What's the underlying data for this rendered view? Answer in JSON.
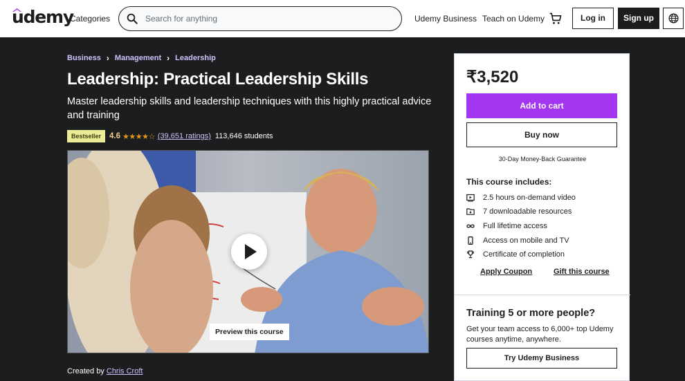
{
  "header": {
    "logo": "udemy",
    "categories": "Categories",
    "search_placeholder": "Search for anything",
    "udemy_business": "Udemy Business",
    "teach": "Teach on Udemy",
    "login": "Log in",
    "signup": "Sign up"
  },
  "breadcrumb": [
    "Business",
    "Management",
    "Leadership"
  ],
  "course": {
    "title": "Leadership: Practical Leadership Skills",
    "subtitle": "Master leadership skills and leadership techniques with this highly practical advice and training",
    "badge": "Bestseller",
    "rating": "4.6",
    "stars": "★★★★☆",
    "ratings_count": "(39,651 ratings)",
    "students": "113,646 students",
    "preview_label": "Preview this course",
    "created_by_label": "Created by",
    "instructor": "Chris Croft"
  },
  "sidebar": {
    "price": "₹3,520",
    "add_to_cart": "Add to cart",
    "buy_now": "Buy now",
    "guarantee": "30-Day Money-Back Guarantee",
    "includes_title": "This course includes:",
    "includes": [
      {
        "icon": "video-icon",
        "text": "2.5 hours on-demand video"
      },
      {
        "icon": "folder-icon",
        "text": "7 downloadable resources"
      },
      {
        "icon": "infinity-icon",
        "text": "Full lifetime access"
      },
      {
        "icon": "mobile-icon",
        "text": "Access on mobile and TV"
      },
      {
        "icon": "trophy-icon",
        "text": "Certificate of completion"
      }
    ],
    "apply_coupon": "Apply Coupon",
    "gift": "Gift this course",
    "training_title": "Training 5 or more people?",
    "training_desc": "Get your team access to 6,000+ top Udemy courses anytime, anywhere.",
    "try_business": "Try Udemy Business"
  },
  "colors": {
    "accent": "#a435f0",
    "dark": "#1c1d1f",
    "breadcrumb": "#cec0fc",
    "badge": "#eceb98",
    "star": "#e59819"
  }
}
